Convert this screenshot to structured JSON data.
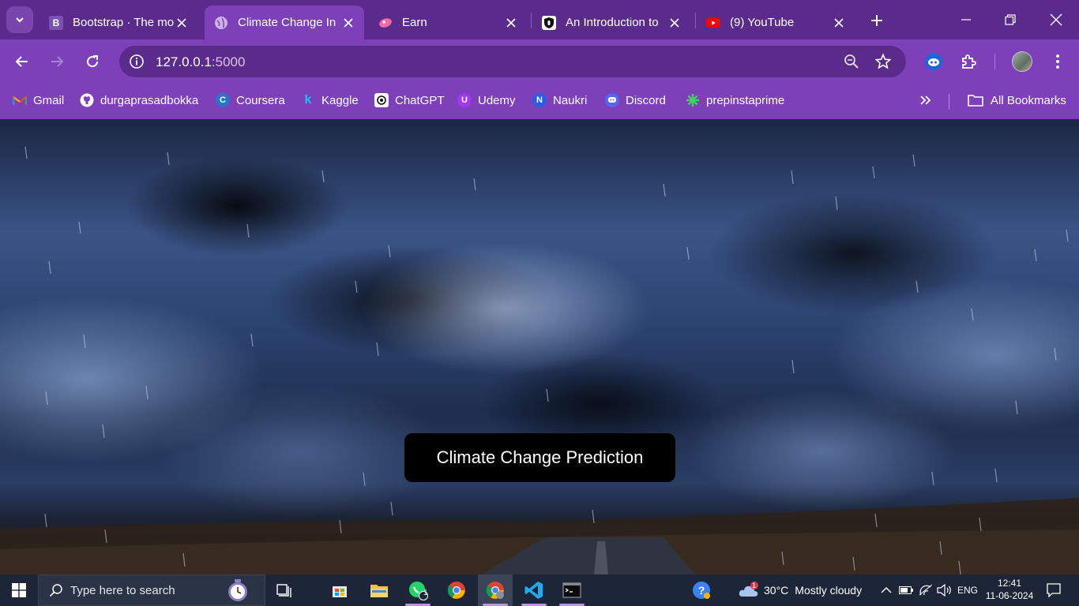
{
  "browser": {
    "tabs": [
      {
        "title": "Bootstrap · The most",
        "favicon": "bootstrap-b",
        "active": false
      },
      {
        "title": "Climate Change In",
        "favicon": "globe",
        "active": true
      },
      {
        "title": "Earn",
        "favicon": "earn-pink",
        "active": false
      },
      {
        "title": "An Introduction to",
        "favicon": "shield-lock",
        "active": false
      },
      {
        "title": "(9) YouTube",
        "favicon": "youtube",
        "active": false
      }
    ],
    "url_host": "127.0.0.1",
    "url_port": ":5000",
    "bookmarks": [
      {
        "label": "Gmail",
        "icon": "gmail"
      },
      {
        "label": "durgaprasadbokka",
        "icon": "github"
      },
      {
        "label": "Coursera",
        "icon": "coursera"
      },
      {
        "label": "Kaggle",
        "icon": "kaggle"
      },
      {
        "label": "ChatGPT",
        "icon": "chatgpt"
      },
      {
        "label": "Udemy",
        "icon": "udemy"
      },
      {
        "label": "Naukri",
        "icon": "naukri"
      },
      {
        "label": "Discord",
        "icon": "discord"
      },
      {
        "label": "prepinstaprime",
        "icon": "prepinsta"
      }
    ],
    "all_bookmarks_label": "All Bookmarks"
  },
  "page": {
    "predict_button_label": "Climate Change Prediction"
  },
  "taskbar": {
    "search_placeholder": "Type here to search",
    "weather_temp": "30°C",
    "weather_text": "Mostly cloudy",
    "weather_badge": "1",
    "whatsapp_badge": "1",
    "language": "ENG",
    "time": "12:41",
    "date": "11-06-2024"
  },
  "colors": {
    "tabstrip": "#5b2b8c",
    "toolbar": "#7d40b8",
    "taskbar": "#1d2639",
    "button": "#000000"
  }
}
